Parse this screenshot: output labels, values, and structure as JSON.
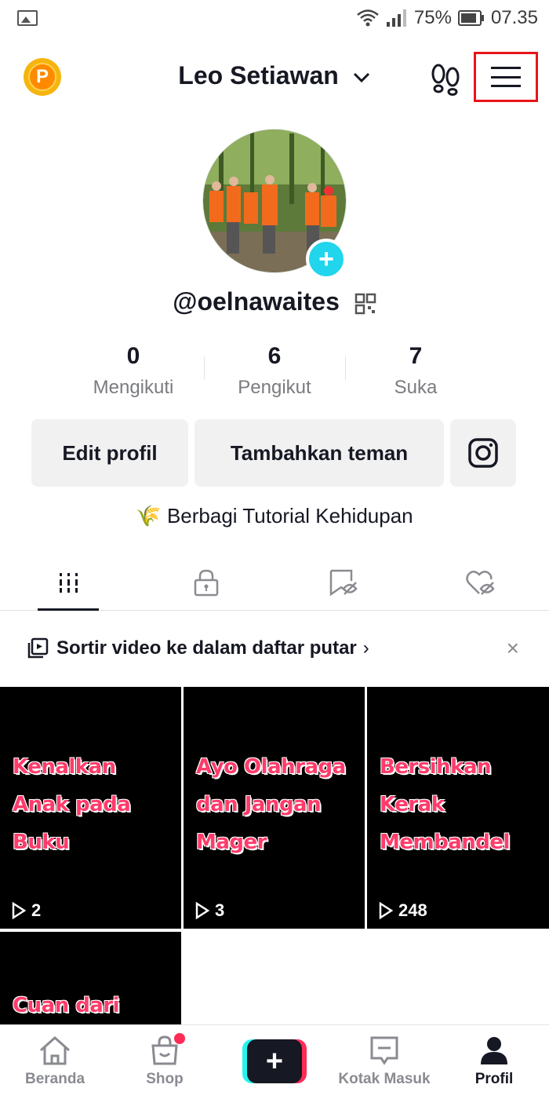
{
  "status_bar": {
    "battery": "75%",
    "time": "07.35"
  },
  "header": {
    "coin_letter": "P",
    "title": "Leo Setiawan"
  },
  "profile": {
    "username": "@oelnawaites",
    "add_symbol": "+",
    "stats": [
      {
        "value": "0",
        "label": "Mengikuti"
      },
      {
        "value": "6",
        "label": "Pengikut"
      },
      {
        "value": "7",
        "label": "Suka"
      }
    ],
    "buttons": {
      "edit": "Edit profil",
      "add_friends": "Tambahkan teman"
    },
    "bio_emoji": "🌾",
    "bio": "Berbagi Tutorial Kehidupan"
  },
  "tabs": [
    "videos-tab",
    "private-tab",
    "hidden-tab",
    "liked-tab"
  ],
  "sort_banner": {
    "text": "Sortir video ke dalam daftar putar",
    "arrow": "›",
    "close": "×"
  },
  "videos": [
    {
      "title_lines": [
        "Kenalkan",
        "Anak pada",
        "Buku"
      ],
      "views": "2"
    },
    {
      "title_lines": [
        "Ayo Olahraga",
        "dan Jangan",
        "Mager"
      ],
      "views": "3"
    },
    {
      "title_lines": [
        "Bersihkan",
        "Kerak",
        "Membandel"
      ],
      "views": "248"
    },
    {
      "title_lines": [
        "Cuan dari"
      ],
      "views": ""
    }
  ],
  "bottom_nav": {
    "home": "Beranda",
    "shop": "Shop",
    "create": "+",
    "inbox": "Kotak Masuk",
    "profile": "Profil"
  },
  "colors": {
    "highlight_box": "#e8141b",
    "accent_cyan": "#20d5ec",
    "accent_pink": "#fe2c55",
    "thumb_title": "#ff3b6a"
  }
}
